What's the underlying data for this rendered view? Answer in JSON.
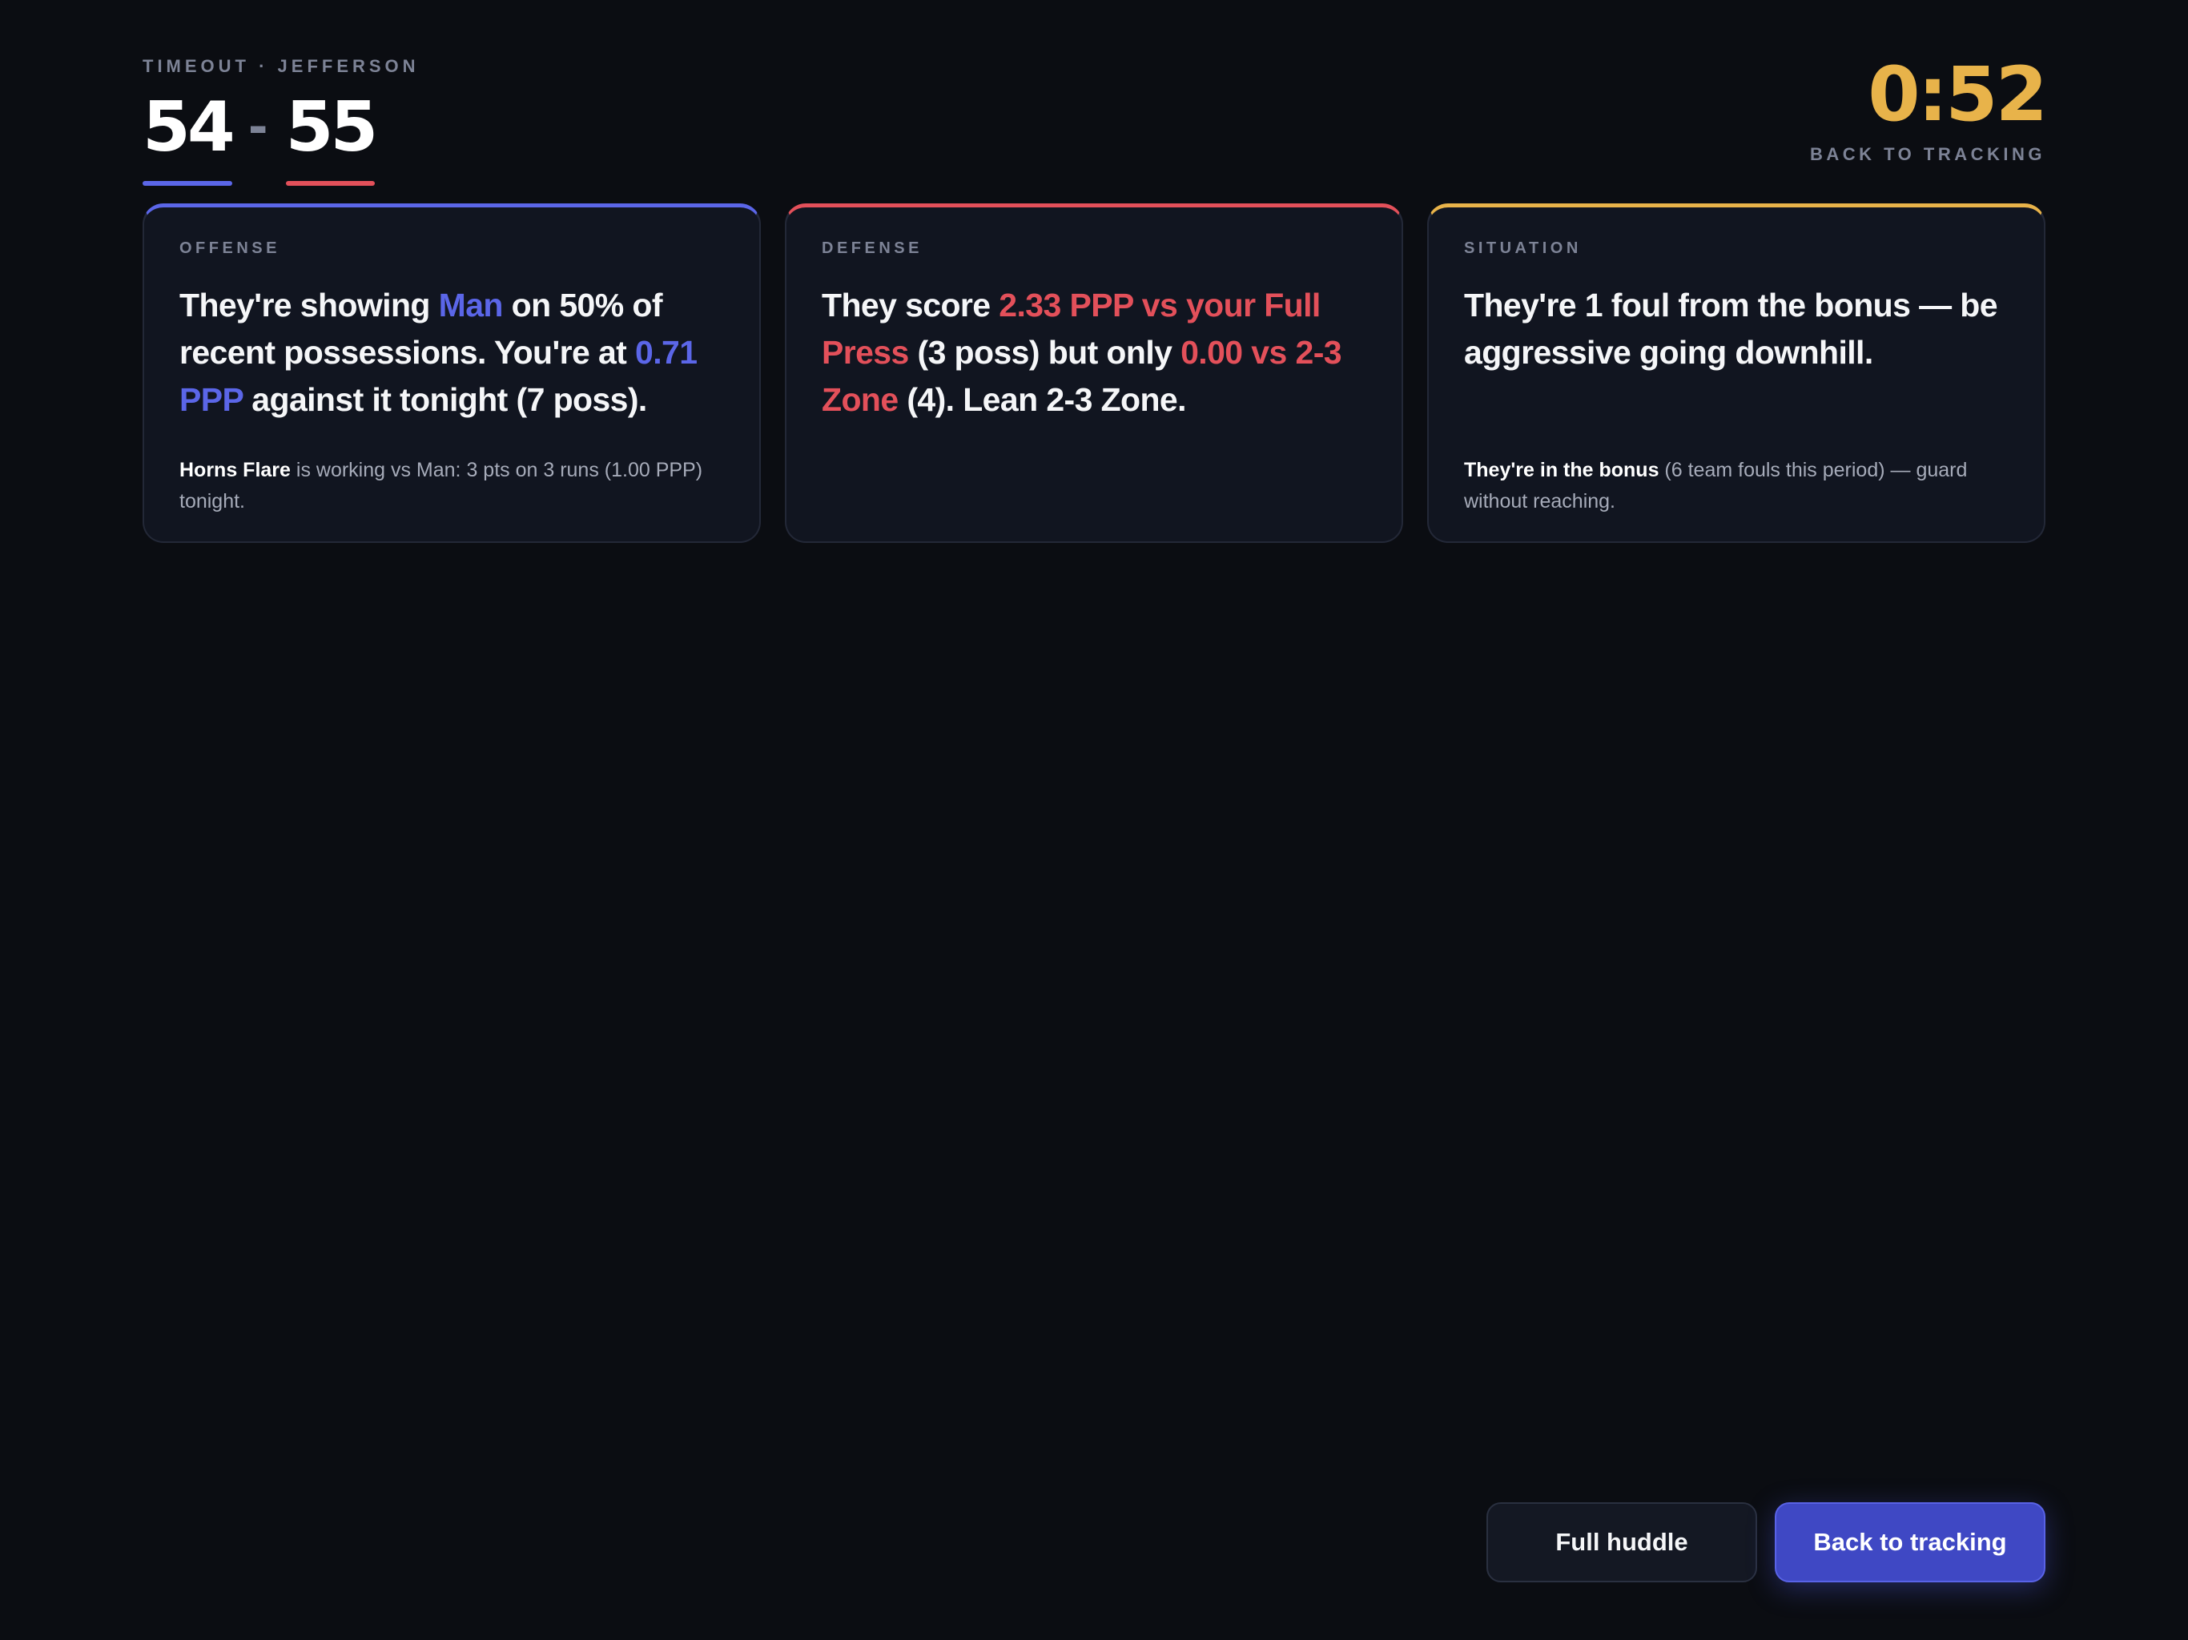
{
  "header": {
    "eyebrow": "TIMEOUT · JEFFERSON",
    "score_home": "54",
    "score_separator": "-",
    "score_away": "55",
    "clock": "0:52",
    "clock_caption": "BACK TO TRACKING"
  },
  "colors": {
    "background": "#0b0d12",
    "card_background": "#111520",
    "offense_accent": "#5b66e8",
    "defense_accent": "#e3505a",
    "situation_accent": "#e8b34a",
    "primary_button": "#3f48c4"
  },
  "cards": {
    "offense": {
      "label": "OFFENSE",
      "headline": {
        "t1": "They're showing ",
        "h1": "Man",
        "t2": " on 50% of recent possessions. You're at ",
        "h2": "0.71 PPP",
        "t3": " against it tonight (7 poss)."
      },
      "note": {
        "strong": "Horns Flare",
        "text": " is working vs Man: 3 pts on 3 runs (1.00 PPP) tonight."
      }
    },
    "defense": {
      "label": "DEFENSE",
      "headline": {
        "t1": "They score ",
        "h1": "2.33 PPP vs your Full Press",
        "t2": " (3 poss) but only ",
        "h2": "0.00 vs 2-3 Zone",
        "t3": " (4). Lean 2-3 Zone."
      }
    },
    "situation": {
      "label": "SITUATION",
      "headline": "They're 1 foul from the bonus — be aggressive going downhill.",
      "note": {
        "strong": "They're in the bonus",
        "text": " (6 team fouls this period) — guard without reaching."
      }
    }
  },
  "actions": {
    "full_huddle": "Full huddle",
    "back_to_tracking": "Back to tracking"
  }
}
